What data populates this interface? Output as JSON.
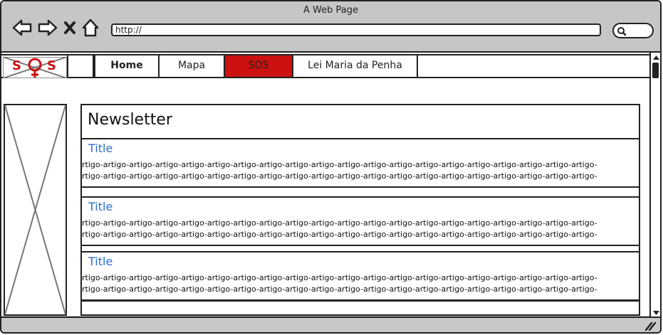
{
  "window": {
    "title": "A Web Page"
  },
  "browser": {
    "back_icon": "back-arrow-icon",
    "forward_icon": "forward-arrow-icon",
    "stop_icon": "close-icon",
    "home_icon": "home-icon",
    "url": "http://",
    "search_icon": "search-icon"
  },
  "nav": {
    "logo_text_left": "S",
    "logo_text_right": "S",
    "items": [
      {
        "label": "Home",
        "active": false
      },
      {
        "label": "Mapa",
        "active": false
      },
      {
        "label": "SOS",
        "active": true
      },
      {
        "label": "Lei Maria da Penha",
        "active": false
      }
    ]
  },
  "newsletter": {
    "heading": "Newsletter",
    "articles": [
      {
        "title": "Title",
        "line1": "rtigo-artigo-artigo-artigo-artigo-artigo-artigo-artigo-artigo-artigo-artigo-artigo-artigo-artigo-artigo-artigo-artigo-artigo-artigo-artigo-",
        "line2": "rtigo-artigo-artigo-artigo-artigo-artigo-artigo-artigo-artigo-artigo-artigo-artigo-artigo-artigo-artigo-artigo-artigo-artigo-artigo-artigo-"
      },
      {
        "title": "Title",
        "line1": "rtigo-artigo-artigo-artigo-artigo-artigo-artigo-artigo-artigo-artigo-artigo-artigo-artigo-artigo-artigo-artigo-artigo-artigo-artigo-artigo-",
        "line2": "rtigo-artigo-artigo-artigo-artigo-artigo-artigo-artigo-artigo-artigo-artigo-artigo-artigo-artigo-artigo-artigo-artigo-artigo-artigo-artigo-"
      },
      {
        "title": "Title",
        "line1": "rtigo-artigo-artigo-artigo-artigo-artigo-artigo-artigo-artigo-artigo-artigo-artigo-artigo-artigo-artigo-artigo-artigo-artigo-artigo-artigo-",
        "line2": "rtigo-artigo-artigo-artigo-artigo-artigo-artigo-artigo-artigo-artigo-artigo-artigo-artigo-artigo-artigo-artigo-artigo-artigo-artigo-artigo-"
      }
    ]
  },
  "colors": {
    "accent_red": "#cc1111",
    "link_blue": "#2a6fcf",
    "chrome_gray": "#c8c8c8"
  }
}
